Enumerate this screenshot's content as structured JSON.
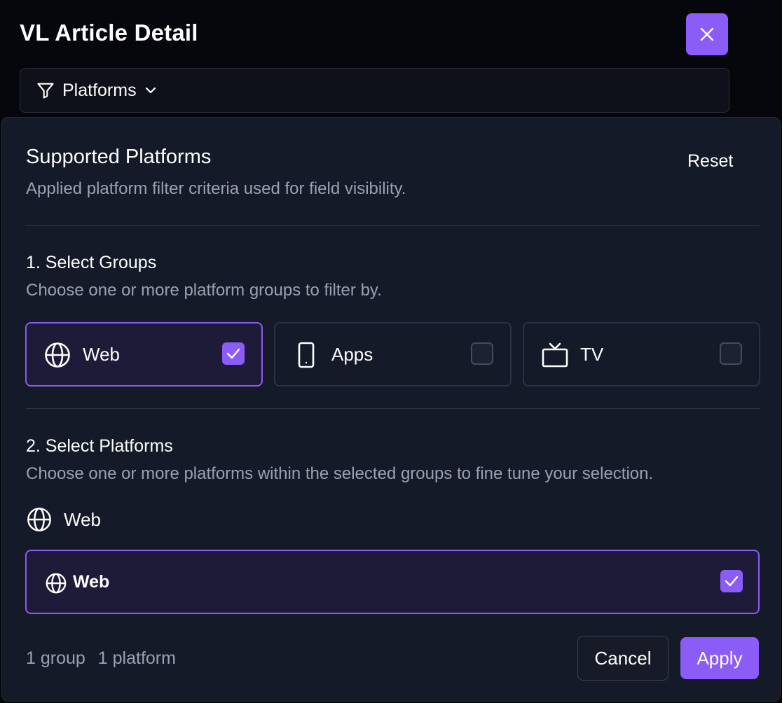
{
  "header": {
    "title": "VL Article Detail",
    "close_icon": "close-icon"
  },
  "filter": {
    "icon": "filter-icon",
    "label": "Platforms",
    "chevron_icon": "chevron-down-icon"
  },
  "panel": {
    "title": "Supported Platforms",
    "subtitle": "Applied platform filter criteria used for field visibility.",
    "reset_label": "Reset",
    "groups_section": {
      "title": "1. Select Groups",
      "description": "Choose one or more platform groups to filter by.",
      "groups": [
        {
          "label": "Web",
          "icon": "globe-icon",
          "checked": true
        },
        {
          "label": "Apps",
          "icon": "mobile-icon",
          "checked": false
        },
        {
          "label": "TV",
          "icon": "tv-icon",
          "checked": false
        }
      ]
    },
    "platforms_section": {
      "title": "2. Select Platforms",
      "description": "Choose one or more platforms within the selected groups to fine tune your selection.",
      "group_heading": {
        "label": "Web",
        "icon": "globe-icon"
      },
      "platforms": [
        {
          "label": "Web",
          "icon": "globe-icon",
          "checked": true
        }
      ]
    },
    "footer": {
      "group_count": "1 group",
      "platform_count": "1 platform",
      "cancel_label": "Cancel",
      "apply_label": "Apply"
    }
  },
  "colors": {
    "accent": "#8b5cf6",
    "background": "#06070d",
    "panel": "#141a27",
    "selected_fill": "#1e1b39",
    "muted_text": "#9aa1b0"
  }
}
